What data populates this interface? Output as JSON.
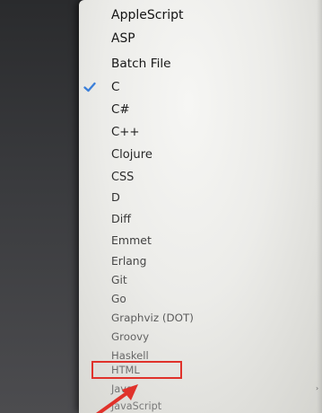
{
  "menu": {
    "items": [
      {
        "label": "AppleScript",
        "checked": false,
        "color": "#141414"
      },
      {
        "label": "ASP",
        "checked": false,
        "color": "#161616"
      },
      {
        "label": "Batch File",
        "checked": false,
        "color": "#181818"
      },
      {
        "label": "C",
        "checked": true,
        "color": "#1c1c1c"
      },
      {
        "label": "C#",
        "checked": false,
        "color": "#202020"
      },
      {
        "label": "C++",
        "checked": false,
        "color": "#242424"
      },
      {
        "label": "Clojure",
        "checked": false,
        "color": "#282828"
      },
      {
        "label": "CSS",
        "checked": false,
        "color": "#2d2d2d"
      },
      {
        "label": "D",
        "checked": false,
        "color": "#333333"
      },
      {
        "label": "Diff",
        "checked": false,
        "color": "#393939"
      },
      {
        "label": "Emmet",
        "checked": false,
        "color": "#404040"
      },
      {
        "label": "Erlang",
        "checked": false,
        "color": "#474747"
      },
      {
        "label": "Git",
        "checked": false,
        "color": "#4f4f4f"
      },
      {
        "label": "Go",
        "checked": false,
        "color": "#555555"
      },
      {
        "label": "Graphviz (DOT)",
        "checked": false,
        "color": "#5c5c5c"
      },
      {
        "label": "Groovy",
        "checked": false,
        "color": "#626262"
      },
      {
        "label": "Haskell",
        "checked": false,
        "color": "#686868"
      },
      {
        "label": "HTML",
        "checked": false,
        "color": "#6e6e6e"
      },
      {
        "label": "Java",
        "checked": false,
        "color": "#747474"
      },
      {
        "label": "JavaScript",
        "checked": false,
        "color": "#7a7a7a"
      }
    ],
    "highlighted_item": "HTML"
  },
  "colors": {
    "check_mark": "#3b7fd9",
    "annotation_red": "#e0322b"
  },
  "icons": {
    "check": "check-icon",
    "annotation_arrow": "arrow-icon"
  }
}
